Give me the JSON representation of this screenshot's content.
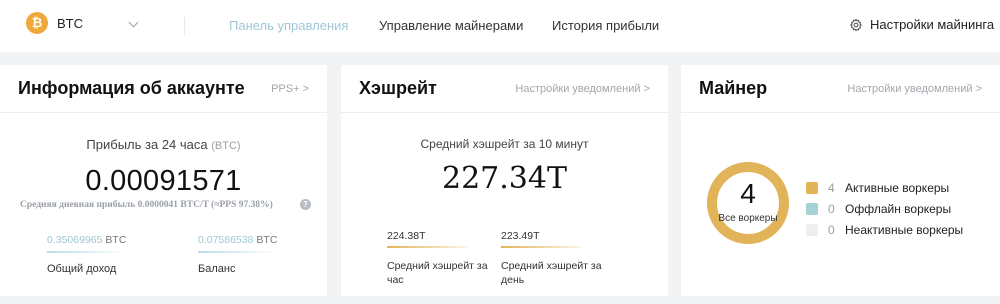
{
  "topbar": {
    "coin": {
      "symbol": "BTC",
      "logo_glyph": "₿",
      "logo_color": "#f0a83a"
    },
    "nav": [
      {
        "label": "Панель управления",
        "active": true
      },
      {
        "label": "Управление майнерами",
        "active": false
      },
      {
        "label": "История прибыли",
        "active": false
      }
    ],
    "settings_label": "Настройки майнинга"
  },
  "account": {
    "title": "Информация об аккаунте",
    "link": "PPS+ >",
    "profit_caption": "Прибыль за 24 часа",
    "profit_unit": "(BTC)",
    "profit_value": "0.00091571",
    "daily_note": "Средняя дневная прибыль 0.0000041 BTC/T (≈PPS 97.38%)",
    "stats": [
      {
        "value": "0.35069965",
        "unit": "BTC",
        "label": "Общий доход"
      },
      {
        "value": "0.07586538",
        "unit": "BTC",
        "label": "Баланс"
      }
    ]
  },
  "hashrate": {
    "title": "Хэшрейт",
    "link": "Настройки уведомлений >",
    "caption": "Средний хэшрейт за 10 минут",
    "value": "227.34T",
    "stats": [
      {
        "value": "224.38T",
        "label": "Средний хэшрейт за час"
      },
      {
        "value": "223.49T",
        "label": "Средний хэшрейт за день"
      }
    ]
  },
  "miner": {
    "title": "Майнер",
    "link": "Настройки уведомлений >",
    "total": "4",
    "total_label": "Все воркеры",
    "legend": [
      {
        "count": "4",
        "label": "Активные воркеры",
        "color": "#e2b45a"
      },
      {
        "count": "0",
        "label": "Оффлайн воркеры",
        "color": "#a7d2d5"
      },
      {
        "count": "0",
        "label": "Неактивные воркеры",
        "color": "#eeeeee"
      }
    ]
  },
  "colors": {
    "accent": "#9fc7d6",
    "active": "#e2b45a",
    "offline": "#a7d2d5",
    "inactive": "#eeeeee"
  }
}
